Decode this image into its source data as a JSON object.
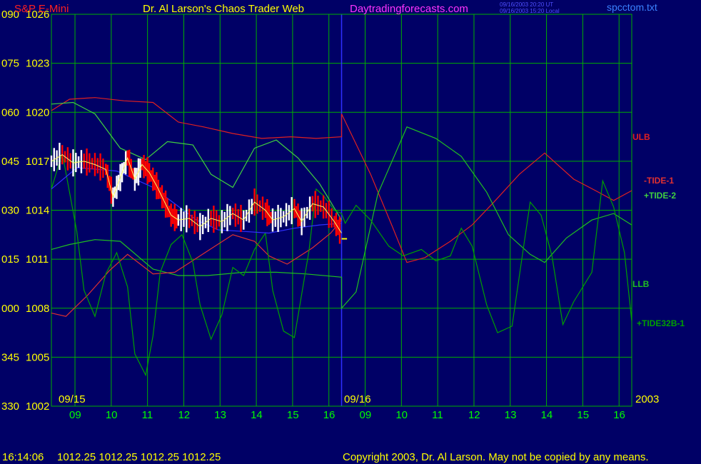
{
  "header": {
    "symbol": "S&P E-Mini",
    "site": "Dr. Al Larson's Chaos Trader Web",
    "url": "Daytradingforecasts.com",
    "time_ut": "09/16/2003 20:20 UT",
    "time_local": "09/16/2003 15:20 Local",
    "file": "spcctom.txt"
  },
  "footer": {
    "clock": "16:14:06",
    "prices": "1012.25 1012.25 1012.25 1012.25",
    "copyright": "Copyright 2003, Dr. Al Larson. May not be copied by any means."
  },
  "colors": {
    "background": "#000066",
    "grid": "#00b000",
    "axis_text": "#ffff00",
    "time_text": "#00ff00",
    "title_red": "#ff2020",
    "url_magenta": "#ff33ff",
    "ulb": "#e02020",
    "llb": "#20c020",
    "tide1": "#e03030",
    "tide2": "#40d040",
    "tide32b": "#00a000",
    "blue": "#3030ff",
    "price_up": "#ffffff",
    "price_down": "#ff0000",
    "today_marker": "#ffff00"
  },
  "chart_data": {
    "type": "line",
    "ylim": [
      1002,
      1026
    ],
    "y_ticks": [
      {
        "angle": "330",
        "price": "1002"
      },
      {
        "angle": "345",
        "price": "1005"
      },
      {
        "angle": "000",
        "price": "1008"
      },
      {
        "angle": "015",
        "price": "1011"
      },
      {
        "angle": "030",
        "price": "1014"
      },
      {
        "angle": "045",
        "price": "1017"
      },
      {
        "angle": "060",
        "price": "1020"
      },
      {
        "angle": "075",
        "price": "1023"
      },
      {
        "angle": "090",
        "price": "1026"
      }
    ],
    "x_range": [
      0,
      16
    ],
    "days": [
      {
        "date": "09/15",
        "hours": [
          "09",
          "10",
          "11",
          "12",
          "13",
          "14",
          "15",
          "16"
        ]
      },
      {
        "date": "09/16",
        "hours": [
          "09",
          "10",
          "11",
          "12",
          "13",
          "14",
          "15",
          "16"
        ]
      }
    ],
    "year": "2003",
    "series": [
      {
        "name": "ULB",
        "key": "ulb",
        "points": [
          [
            0,
            1020.1
          ],
          [
            0.5,
            1020.8
          ],
          [
            1.2,
            1020.9
          ],
          [
            2.0,
            1020.7
          ],
          [
            2.8,
            1020.6
          ],
          [
            3.5,
            1019.4
          ],
          [
            4.2,
            1019.1
          ],
          [
            5.0,
            1018.7
          ],
          [
            5.8,
            1018.4
          ],
          [
            6.6,
            1018.5
          ],
          [
            7.3,
            1018.4
          ],
          [
            8.0,
            1018.5
          ],
          [
            8.0,
            1019.9
          ],
          [
            8.8,
            1016.2
          ],
          [
            9.4,
            1013.0
          ],
          [
            9.8,
            1010.8
          ],
          [
            10.3,
            1011.1
          ],
          [
            11.0,
            1012.1
          ],
          [
            11.6,
            1013.1
          ],
          [
            12.2,
            1014.5
          ],
          [
            12.9,
            1016.2
          ],
          [
            13.6,
            1017.5
          ],
          [
            14.4,
            1015.9
          ],
          [
            15.0,
            1015.2
          ],
          [
            15.5,
            1014.6
          ],
          [
            16.0,
            1015.2
          ]
        ]
      },
      {
        "name": "LLB",
        "key": "llb",
        "points": [
          [
            0,
            1011.6
          ],
          [
            0.5,
            1011.9
          ],
          [
            1.2,
            1012.2
          ],
          [
            1.9,
            1012.1
          ],
          [
            2.8,
            1010.4
          ],
          [
            3.5,
            1010.0
          ],
          [
            4.3,
            1010.0
          ],
          [
            5.3,
            1010.2
          ],
          [
            6.2,
            1010.2
          ],
          [
            7.0,
            1010.1
          ],
          [
            8.0,
            1009.9
          ],
          [
            8.0,
            1008.0
          ],
          [
            8.4,
            1009.0
          ],
          [
            9.0,
            1015.0
          ],
          [
            9.8,
            1019.1
          ],
          [
            10.6,
            1018.4
          ],
          [
            11.3,
            1017.3
          ],
          [
            12.0,
            1015.1
          ],
          [
            12.6,
            1012.5
          ],
          [
            13.2,
            1011.3
          ],
          [
            13.6,
            1010.8
          ],
          [
            14.2,
            1012.3
          ],
          [
            14.9,
            1013.4
          ],
          [
            15.5,
            1013.8
          ],
          [
            16.0,
            1013.1
          ]
        ]
      },
      {
        "name": "-TIDE-1",
        "key": "tide1",
        "points": [
          [
            0,
            1007.7
          ],
          [
            0.4,
            1007.5
          ],
          [
            1.0,
            1008.8
          ],
          [
            1.6,
            1010.3
          ],
          [
            2.1,
            1011.3
          ],
          [
            2.8,
            1010.1
          ],
          [
            3.4,
            1010.2
          ],
          [
            4.3,
            1011.5
          ],
          [
            5.0,
            1012.5
          ],
          [
            5.6,
            1012.1
          ],
          [
            6.0,
            1011.2
          ],
          [
            6.5,
            1010.7
          ],
          [
            7.2,
            1011.7
          ],
          [
            7.7,
            1012.6
          ],
          [
            8.0,
            1013.4
          ]
        ]
      },
      {
        "name": "+TIDE-2",
        "key": "tide2",
        "points": [
          [
            0,
            1020.5
          ],
          [
            0.6,
            1020.6
          ],
          [
            1.2,
            1019.9
          ],
          [
            1.9,
            1017.8
          ],
          [
            2.6,
            1017.1
          ],
          [
            3.2,
            1018.2
          ],
          [
            3.9,
            1018.0
          ],
          [
            4.4,
            1016.2
          ],
          [
            5.0,
            1015.4
          ],
          [
            5.6,
            1017.8
          ],
          [
            6.2,
            1018.3
          ],
          [
            6.8,
            1017.2
          ],
          [
            7.4,
            1015.6
          ],
          [
            8.0,
            1013.4
          ]
        ]
      },
      {
        "name": "+TIDE32B-1",
        "key": "tide32b",
        "points": [
          [
            0,
            1015.3
          ],
          [
            0.3,
            1017.5
          ],
          [
            0.7,
            1012.7
          ],
          [
            0.9,
            1009.1
          ],
          [
            1.2,
            1007.5
          ],
          [
            1.5,
            1010.1
          ],
          [
            1.8,
            1011.4
          ],
          [
            2.1,
            1009.3
          ],
          [
            2.3,
            1005.2
          ],
          [
            2.6,
            1003.9
          ],
          [
            2.8,
            1006.3
          ],
          [
            3.0,
            1010.2
          ],
          [
            3.3,
            1011.9
          ],
          [
            3.6,
            1012.5
          ],
          [
            3.9,
            1010.8
          ],
          [
            4.1,
            1008.2
          ],
          [
            4.4,
            1006.1
          ],
          [
            4.7,
            1007.6
          ],
          [
            5.0,
            1010.5
          ],
          [
            5.3,
            1010.0
          ],
          [
            5.6,
            1011.6
          ],
          [
            5.9,
            1012.6
          ],
          [
            6.1,
            1009.1
          ],
          [
            6.4,
            1006.6
          ],
          [
            6.7,
            1006.2
          ],
          [
            7.1,
            1011.5
          ],
          [
            7.3,
            1015.3
          ],
          [
            7.5,
            1014.9
          ],
          [
            7.8,
            1014.0
          ],
          [
            8.0,
            1013.8
          ],
          [
            8.1,
            1013.2
          ],
          [
            8.4,
            1014.3
          ],
          [
            8.8,
            1013.4
          ],
          [
            9.3,
            1011.8
          ],
          [
            9.7,
            1011.2
          ],
          [
            10.2,
            1011.6
          ],
          [
            10.6,
            1010.9
          ],
          [
            11.0,
            1011.2
          ],
          [
            11.3,
            1012.9
          ],
          [
            11.6,
            1011.8
          ],
          [
            12.0,
            1008.2
          ],
          [
            12.3,
            1006.5
          ],
          [
            12.7,
            1006.9
          ],
          [
            13.0,
            1011.5
          ],
          [
            13.2,
            1014.5
          ],
          [
            13.5,
            1013.7
          ],
          [
            13.8,
            1011.2
          ],
          [
            14.1,
            1007.0
          ],
          [
            14.4,
            1008.4
          ],
          [
            14.9,
            1010.2
          ],
          [
            15.2,
            1015.8
          ],
          [
            15.5,
            1014.2
          ],
          [
            15.8,
            1011.4
          ],
          [
            16.0,
            1007.2
          ],
          [
            16.0,
            1014.2
          ]
        ]
      },
      {
        "name": "",
        "key": "blue",
        "points": [
          [
            0,
            1015.3
          ],
          [
            0.7,
            1016.6
          ],
          [
            1.3,
            1016.5
          ],
          [
            1.8,
            1016.4
          ],
          [
            2.3,
            1015.9
          ],
          [
            2.8,
            1015.4
          ],
          [
            3.4,
            1014.4
          ],
          [
            4.0,
            1013.4
          ],
          [
            4.6,
            1012.8
          ],
          [
            5.3,
            1012.7
          ],
          [
            6.0,
            1012.6
          ],
          [
            6.7,
            1012.9
          ],
          [
            7.4,
            1013.1
          ],
          [
            8.0,
            1013.2
          ]
        ]
      },
      {
        "name": "",
        "key": "price",
        "points": [
          [
            0,
            1017.0
          ],
          [
            0.3,
            1017.4
          ],
          [
            0.6,
            1016.9
          ],
          [
            0.9,
            1017.0
          ],
          [
            1.2,
            1016.8
          ],
          [
            1.5,
            1016.5
          ],
          [
            1.7,
            1014.8
          ],
          [
            1.9,
            1016.0
          ],
          [
            2.1,
            1017.2
          ],
          [
            2.3,
            1015.9
          ],
          [
            2.5,
            1016.8
          ],
          [
            2.7,
            1016.3
          ],
          [
            2.9,
            1015.5
          ],
          [
            3.1,
            1014.6
          ],
          [
            3.3,
            1013.7
          ],
          [
            3.5,
            1013.4
          ],
          [
            3.8,
            1013.5
          ],
          [
            4.1,
            1013.0
          ],
          [
            4.4,
            1013.5
          ],
          [
            4.7,
            1013.3
          ],
          [
            5.0,
            1013.8
          ],
          [
            5.3,
            1013.4
          ],
          [
            5.6,
            1014.5
          ],
          [
            5.9,
            1014.0
          ],
          [
            6.1,
            1013.4
          ],
          [
            6.4,
            1013.6
          ],
          [
            6.7,
            1014.1
          ],
          [
            6.9,
            1013.3
          ],
          [
            7.2,
            1014.4
          ],
          [
            7.5,
            1014.2
          ],
          [
            7.8,
            1013.3
          ],
          [
            8.0,
            1012.6
          ]
        ]
      }
    ],
    "today_marker": 1012.25
  }
}
